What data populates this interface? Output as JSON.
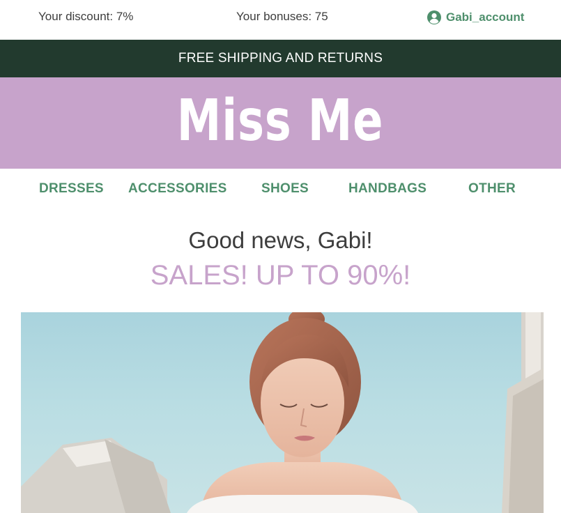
{
  "colors": {
    "green": "#4e8f6c",
    "dark_bar": "#223a2e",
    "lilac": "#c7a3cb",
    "text": "#3d3d3d"
  },
  "topbar": {
    "discount": "Your discount: 7%",
    "bonuses": "Your bonuses: 75",
    "account_label": "Gabi_account",
    "account_icon": "user-circle-icon"
  },
  "shipping": {
    "text": "FREE SHIPPING AND RETURNS"
  },
  "brand": {
    "logo": "Miss Me"
  },
  "nav": {
    "items": [
      {
        "label": "DRESSES"
      },
      {
        "label": "ACCESSORIES"
      },
      {
        "label": "SHOES"
      },
      {
        "label": "HANDBAGS"
      },
      {
        "label": "OTHER"
      }
    ]
  },
  "headline": {
    "greeting": "Good news, Gabi!",
    "sales": "SALES! UP TO 90%!"
  }
}
